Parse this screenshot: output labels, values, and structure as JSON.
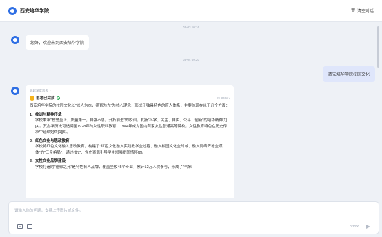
{
  "header": {
    "app_title": "西安培华学院",
    "clear_label": "清空对话"
  },
  "chat": {
    "ts1": "03-03 10:16",
    "greeting": "您好，欢迎来到西安培华学院",
    "ts2": "03-04 09:20",
    "user_message": "西安培华学院校园文化",
    "reply": {
      "deep_label": "收起深度思考",
      "think_label": "思考已完成",
      "think_time": "21.893s",
      "intro": "西安培华学院的校园文化以\"以人为本，德育为先\"为核心理念，形成了独具特色的育人体系，主要体现在以下几个方面：",
      "sections": [
        {
          "num": "1.",
          "title": "校训与精神传承",
          "text": "学校秉承\"校誉至上，质量第一，自强不息，开拓前进\"的校训，发扬\"科学、民主、自由、公平、创新\"的培华精神[1][4]。其办学历史可追溯至1928年的女性职业教育，1984年成为国内首家女性普通高等院校，女性教育特色在历史传承中延续始终[1][6]。"
        },
        {
          "num": "2.",
          "title": "红色文化与思政教育",
          "text": "学校将红色文化融入思政教育，构建了\"红色文化融入实践教学全过程、融入校园文化全时域、融入网络阵地全媒体\"的\"三全格局\"，通过校史、党史资源引导学生增强爱国情怀[2]。"
        },
        {
          "num": "3.",
          "title": "女性文化品牌建设",
          "text": "学校打造的\"德修之苑\"是特色育人品牌，覆盖全校45个专业，累计12万人次参与，形成了\"气象"
        }
      ]
    }
  },
  "input": {
    "placeholder": "请输入你的问题，支持上传图片或文件。",
    "value": "",
    "counter": "0/3000"
  },
  "icons": {
    "logo": "school-logo-icon",
    "clear": "trash-icon",
    "image": "image-icon",
    "folder": "folder-icon",
    "send": "send-icon"
  },
  "colors": {
    "accent": "#2f6fe4",
    "user_bubble": "#dfe6fb",
    "background": "#eef1f6"
  }
}
